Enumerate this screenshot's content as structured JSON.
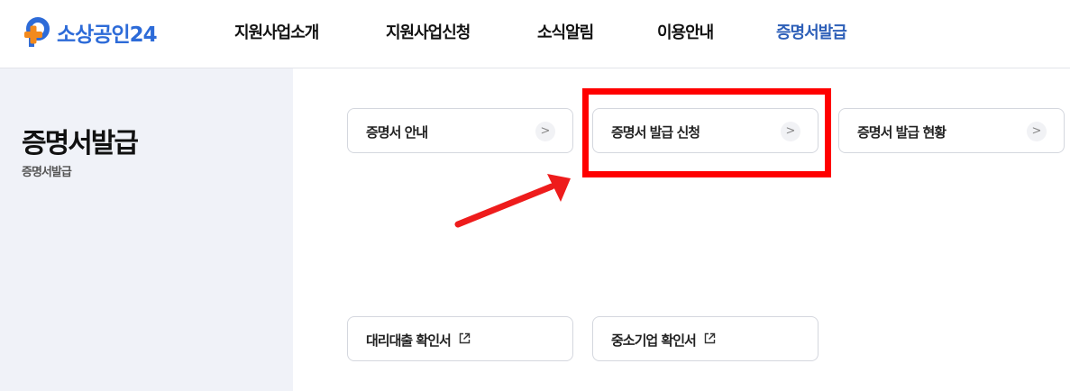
{
  "brand": {
    "name": "소상공인24",
    "colors": {
      "blue": "#2d6bd8",
      "orange": "#f28a1e"
    }
  },
  "nav": {
    "items": [
      {
        "label": "지원사업소개",
        "active": false
      },
      {
        "label": "지원사업신청",
        "active": false
      },
      {
        "label": "소식알림",
        "active": false
      },
      {
        "label": "이용안내",
        "active": false
      },
      {
        "label": "증명서발급",
        "active": true
      }
    ],
    "active_color": "#2d5fb8"
  },
  "sidebar": {
    "title": "증명서발급",
    "breadcrumb": "증명서발급"
  },
  "cards": {
    "row1": [
      {
        "label": "증명서 안내",
        "icon": "chevron-right-icon"
      },
      {
        "label": "증명서 발급 신청",
        "icon": "chevron-right-icon"
      },
      {
        "label": "증명서 발급 현황",
        "icon": "chevron-right-icon"
      }
    ],
    "row2": [
      {
        "label": "대리대출 확인서",
        "icon": "external-link-icon"
      },
      {
        "label": "중소기업 확인서",
        "icon": "external-link-icon"
      }
    ]
  },
  "annotation": {
    "highlight_color": "#ff0000"
  }
}
